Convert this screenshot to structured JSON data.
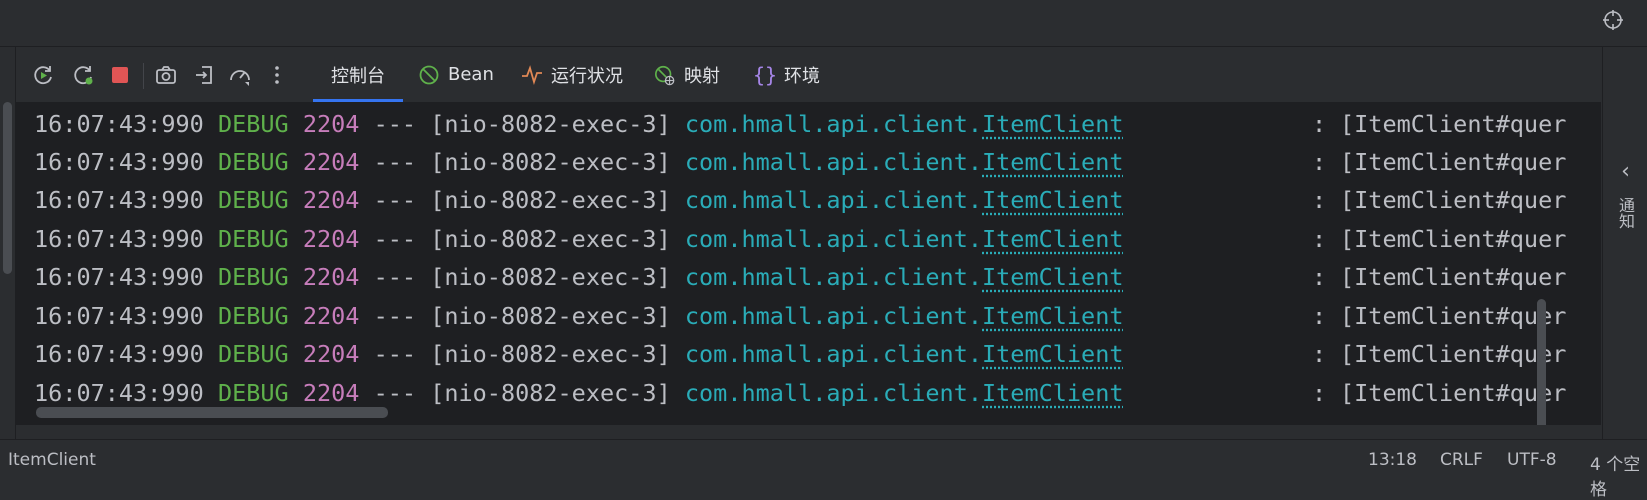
{
  "toolbar": {
    "tabs": [
      {
        "label": "控制台",
        "icon": "console-icon"
      },
      {
        "label": "Bean",
        "icon": "bean-icon"
      },
      {
        "label": "运行状况",
        "icon": "health-icon"
      },
      {
        "label": "映射",
        "icon": "mapping-icon"
      },
      {
        "label": "环境",
        "icon": "environment-icon"
      }
    ],
    "actions": [
      "rerun-icon",
      "rerun-debug-icon",
      "stop-icon",
      "screenshot-icon",
      "exit-icon",
      "performance-icon",
      "more-icon"
    ]
  },
  "log": {
    "timestamp": "16:07:43:990",
    "level": "DEBUG",
    "pid": "2204",
    "separator": "---",
    "thread": "[nio-8082-exec-3]",
    "logger_package": "com.hmall.api.client.",
    "logger_class": "ItemClient",
    "colon": ":",
    "message": "[ItemClient#quer",
    "row_count": 8
  },
  "right_panel": {
    "label": "通知"
  },
  "status": {
    "breadcrumb": "ItemClient",
    "position": "13:18",
    "line_ending": "CRLF",
    "encoding": "UTF-8",
    "indent": "4 个空格"
  },
  "colors": {
    "accent": "#3574f0",
    "stop": "#e05555",
    "debug": "#5fb14b",
    "pid": "#c77dbb",
    "logger": "#2aacb8"
  }
}
